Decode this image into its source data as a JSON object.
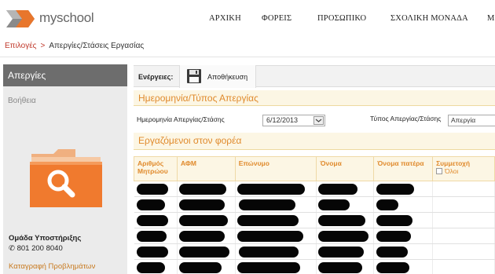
{
  "app": {
    "logo_text": "myschool"
  },
  "nav": [
    {
      "label": "ΑΡΧΙΚΗ"
    },
    {
      "label": "ΦΟΡΕΙΣ"
    },
    {
      "label": "ΠΡΟΣΩΠΙΚΟ"
    },
    {
      "label": "ΣΧΟΛΙΚΗ ΜΟΝΑΔΑ"
    },
    {
      "label": "Μ"
    }
  ],
  "breadcrumb": {
    "root": "Επιλογές",
    "separator": ">",
    "current": "Απεργίες/Στάσεις Εργασίας"
  },
  "sidebar": {
    "title": "Απεργίες",
    "help": "Βοήθεια",
    "team": "Ομάδα Υποστήριξης",
    "phone": "801 200 8040",
    "report": "Καταγραφή Προβλημάτων"
  },
  "actions": {
    "label": "Ενέργειες:",
    "save": "Αποθήκευση"
  },
  "section_strike": {
    "title": "Ημερομηνία/Τύπος Απεργίας"
  },
  "fields": {
    "date_label": "Ημερομηνία Απεργίας/Στάσης",
    "date_value": "6/12/2013",
    "type_label": "Τύπος Απεργίας/Στάσης",
    "type_value": "Απεργία"
  },
  "section_employees": {
    "title": "Εργαζόμενοι στον φορέα"
  },
  "table": {
    "headers": {
      "registry": "Αριθμός Μητρώου",
      "afm": "ΑΦΜ",
      "surname": "Επώνυμο",
      "name": "Όνομα",
      "father": "Όνομα πατέρα",
      "participation": "Συμμετοχή",
      "all": "Όλοι"
    },
    "row_count": 6
  },
  "colors": {
    "accent": "#e08a2c",
    "link": "#c0392b",
    "sidebar_head": "#6d6d6d"
  }
}
